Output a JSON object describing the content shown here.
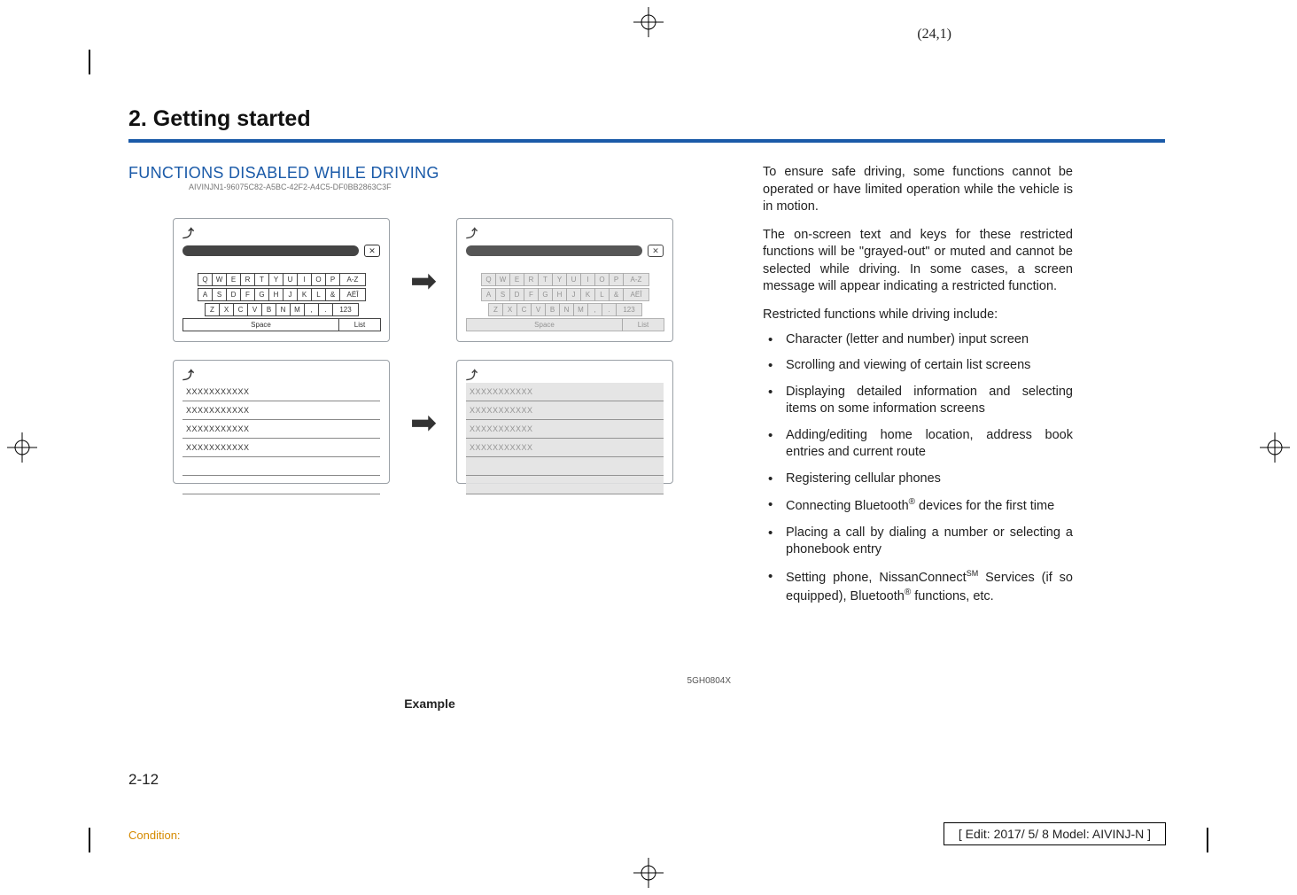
{
  "page_coord": "(24,1)",
  "chapter": "2. Getting started",
  "section_heading": "FUNCTIONS DISABLED WHILE DRIVING",
  "guid": "AIVINJN1-96075C82-A5BC-42F2-A4C5-DF0BB2863C3F",
  "figure": {
    "label": "Example",
    "image_id": "5GH0804X",
    "kb_rows": [
      [
        "Q",
        "W",
        "E",
        "R",
        "T",
        "Y",
        "U",
        "I",
        "O",
        "P",
        "A-Z"
      ],
      [
        "A",
        "S",
        "D",
        "F",
        "G",
        "H",
        "J",
        "K",
        "L",
        "&",
        "AËÎ"
      ],
      [
        "Z",
        "X",
        "C",
        "V",
        "B",
        "N",
        "M",
        ",",
        ".",
        "123"
      ]
    ],
    "kb_bottom": {
      "space": "Space",
      "list": "List"
    },
    "list_placeholder": "XXXXXXXXXXX",
    "list_rows_count": 4,
    "blank_rows_count": 2
  },
  "paragraphs": [
    "To ensure safe driving, some functions cannot be operated or have limited operation while the vehicle is in motion.",
    "The on-screen text and keys for these restricted functions will be \"grayed-out\" or muted and cannot be selected while driving. In some cases, a screen message will appear indicating a restricted function.",
    "Restricted functions while driving include:"
  ],
  "bullets": [
    "Character (letter and number) input screen",
    "Scrolling and viewing of certain list screens",
    "Displaying detailed information and selecting items on some information screens",
    "Adding/editing home location, address book entries and current route",
    "Registering cellular phones",
    {
      "pre": "Connecting Bluetooth",
      "sup": "®",
      "post": " devices for the first time"
    },
    "Placing a call by dialing a number or selecting a phonebook entry",
    {
      "pre": "Setting phone, NissanConnect",
      "sup": "SM",
      "post_pre": " Services (if so equipped), Bluetooth",
      "sup2": "®",
      "post": " functions, etc."
    }
  ],
  "page_number": "2-12",
  "condition_label": "Condition:",
  "edit_stamp": "[ Edit: 2017/ 5/ 8   Model: AIVINJ-N ]"
}
